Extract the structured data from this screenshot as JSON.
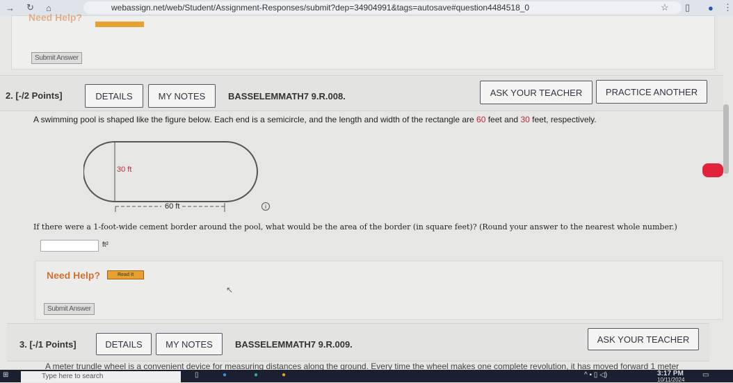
{
  "browser": {
    "url": "webassign.net/web/Student/Assignment-Responses/submit?dep=34904991&tags=autosave#question4484518_0"
  },
  "prev": {
    "need_help": "Need Help?",
    "submit": "Submit Answer"
  },
  "q2": {
    "number": "2.",
    "points": "[-/2 Points]",
    "details": "DETAILS",
    "my_notes": "MY NOTES",
    "code": "BASSELEMMATH7 9.R.008.",
    "ask": "ASK YOUR TEACHER",
    "practice": "PRACTICE ANOTHER",
    "text_a": "A swimming pool is shaped like the figure below. Each end is a semicircle, and the length and width of the rectangle are ",
    "len": "60",
    "text_b": " feet and ",
    "wid": "30",
    "text_c": " feet, respectively.",
    "fig_width": "30 ft",
    "fig_length": "60 ft",
    "question": "If there were a 1-foot-wide cement border around the pool, what would be the area of the border (in square feet)? (Round your answer to the nearest whole number.)",
    "answer": "",
    "unit": "ft²",
    "need_help": "Need Help?",
    "read_it": "Read It",
    "submit": "Submit Answer"
  },
  "q3": {
    "number": "3.",
    "points": "[-/1 Points]",
    "details": "DETAILS",
    "my_notes": "MY NOTES",
    "code": "BASSELEMMATH7 9.R.009.",
    "ask": "ASK YOUR TEACHER",
    "text": "A meter trundle wheel is a convenient device for measuring distances along the ground. Every time the wheel makes one complete revolution, it has moved forward 1 meter"
  },
  "taskbar": {
    "search": "Type here to search",
    "time": "3:17 PM",
    "date": "10/11/2024"
  }
}
